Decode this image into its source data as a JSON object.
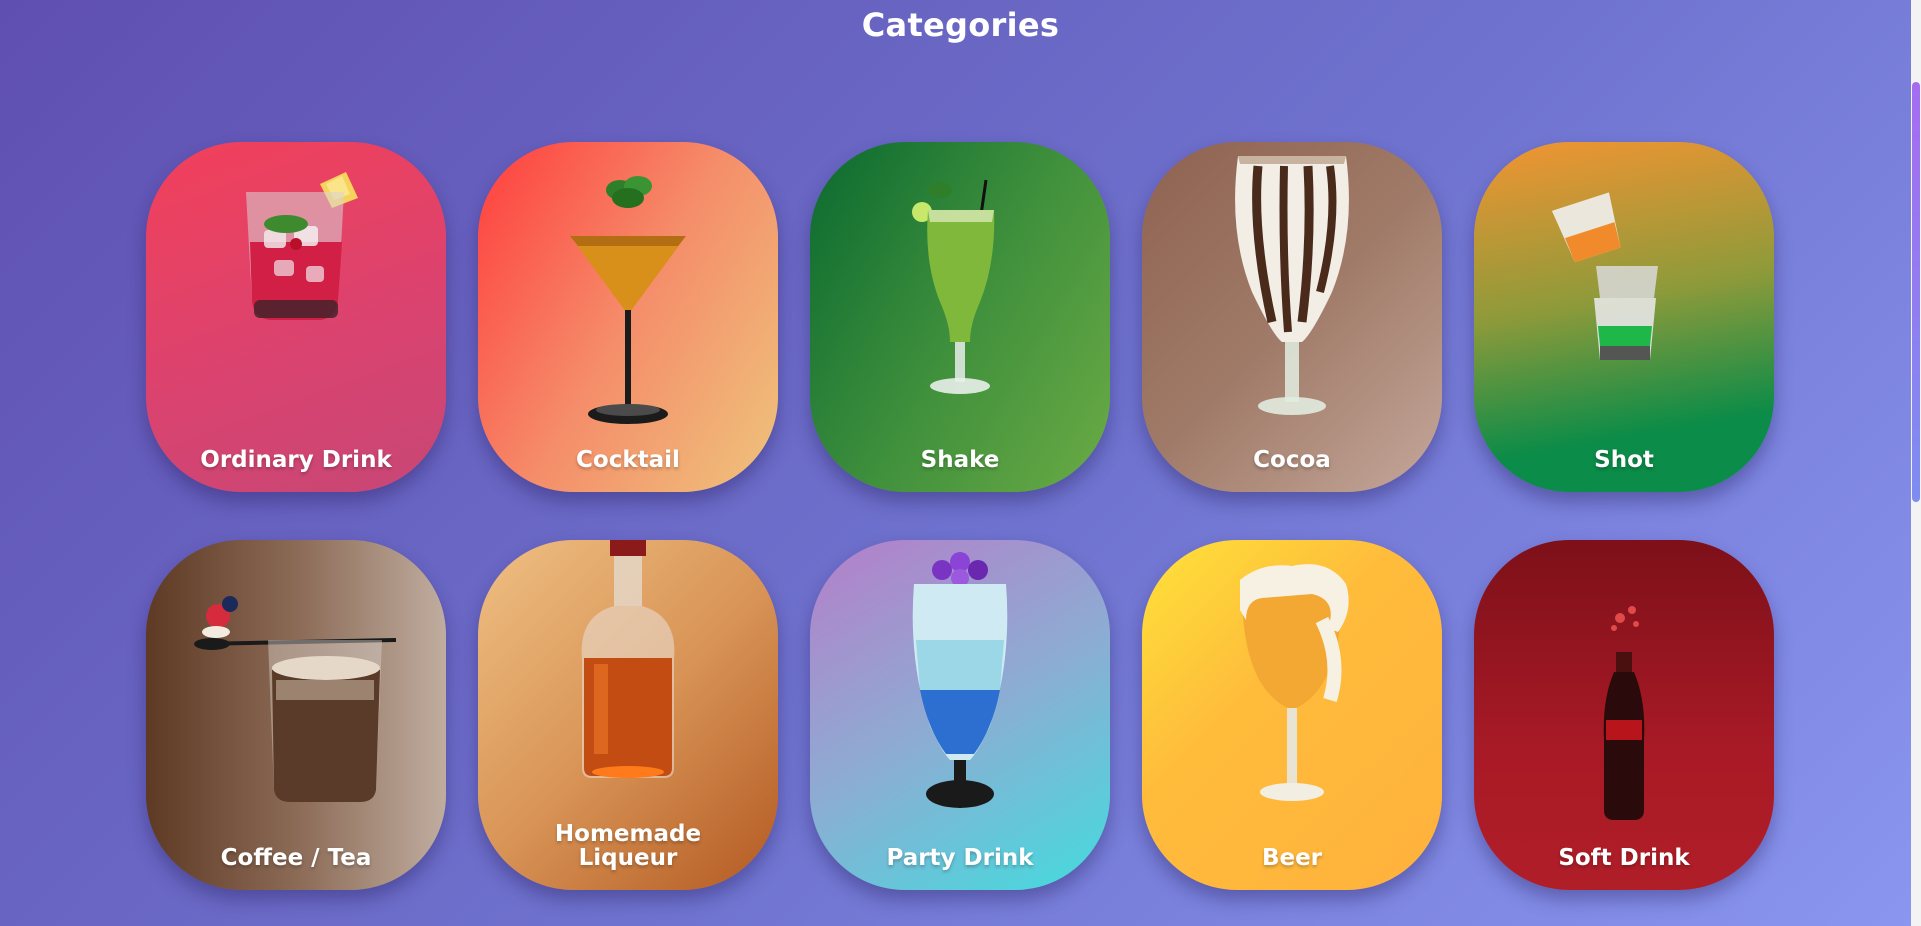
{
  "page": {
    "title": "Categories"
  },
  "categories": [
    {
      "label": "Ordinary Drink",
      "icon": "ordinary-drink-glass-icon"
    },
    {
      "label": "Cocktail",
      "icon": "cocktail-glass-icon"
    },
    {
      "label": "Shake",
      "icon": "shake-glass-icon"
    },
    {
      "label": "Cocoa",
      "icon": "cocoa-glass-icon"
    },
    {
      "label": "Shot",
      "icon": "shot-glasses-icon"
    },
    {
      "label": "Coffee / Tea",
      "icon": "coffee-glass-icon"
    },
    {
      "label": "Homemade Liqueur",
      "icon": "liqueur-bottle-icon"
    },
    {
      "label": "Party Drink",
      "icon": "party-drink-glass-icon"
    },
    {
      "label": "Beer",
      "icon": "beer-glass-icon"
    },
    {
      "label": "Soft Drink",
      "icon": "soda-bottle-icon"
    }
  ],
  "colors": {
    "background_start": "#5f4fb0",
    "background_end": "#8a96f0",
    "text": "#ffffff"
  }
}
